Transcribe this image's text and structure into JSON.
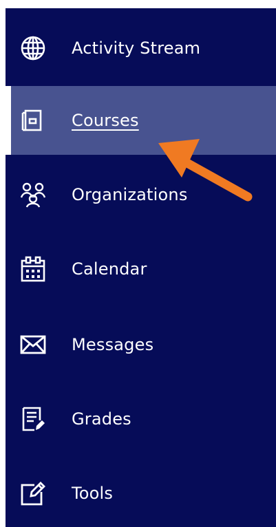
{
  "colors": {
    "nav_background": "#060c58",
    "active_background": "#485390",
    "active_marker": "#ffffff",
    "text": "#ffffff",
    "annotation_arrow": "#f07a22"
  },
  "nav": {
    "active_item": "courses",
    "items": [
      {
        "id": "activity-stream",
        "label": "Activity Stream",
        "icon": "globe-icon"
      },
      {
        "id": "courses",
        "label": "Courses",
        "icon": "courses-icon"
      },
      {
        "id": "organizations",
        "label": "Organizations",
        "icon": "people-icon"
      },
      {
        "id": "calendar",
        "label": "Calendar",
        "icon": "calendar-icon"
      },
      {
        "id": "messages",
        "label": "Messages",
        "icon": "envelope-icon"
      },
      {
        "id": "grades",
        "label": "Grades",
        "icon": "grades-icon"
      },
      {
        "id": "tools",
        "label": "Tools",
        "icon": "tools-icon"
      }
    ]
  }
}
